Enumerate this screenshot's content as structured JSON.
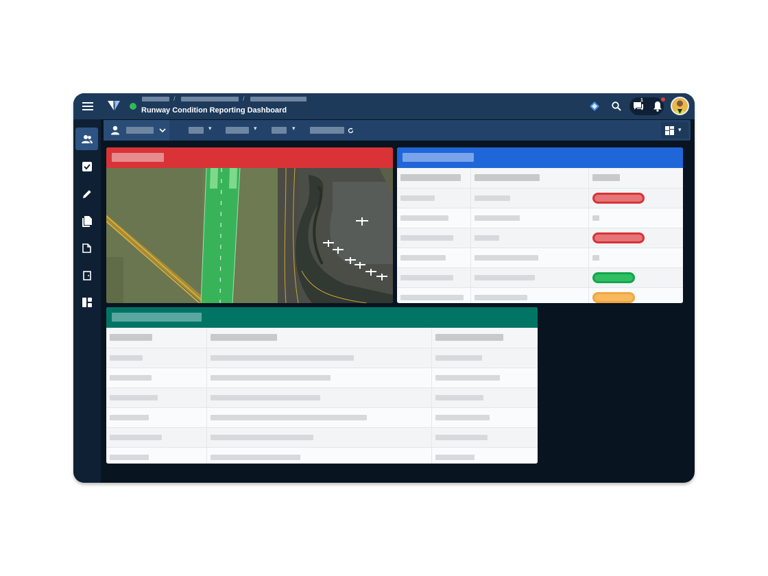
{
  "app": {
    "title": "Runway Condition Reporting Dashboard",
    "status": "online",
    "status_color": "#30b956",
    "breadcrumbs": [
      "",
      "",
      ""
    ],
    "messages_count": "1"
  },
  "icons": {
    "menu": "hamburger-icon",
    "logo": "shield-logo-icon",
    "ai": "diamond-icon",
    "search": "search-icon",
    "messages": "chat-icon",
    "notifications": "bell-icon",
    "user": "user-icon",
    "layout": "layout-grid-icon",
    "refresh": "refresh-icon"
  },
  "toolbar": {
    "user_label": "",
    "filters": [
      "",
      "",
      ""
    ],
    "refresh_label": ""
  },
  "sidebar": {
    "items": [
      {
        "icon": "users-icon",
        "active": true
      },
      {
        "icon": "checkbox-icon",
        "active": false
      },
      {
        "icon": "pencil-icon",
        "active": false
      },
      {
        "icon": "documents-icon",
        "active": false
      },
      {
        "icon": "note-icon",
        "active": false
      },
      {
        "icon": "door-icon",
        "active": false
      },
      {
        "icon": "dashboard-icon",
        "active": false
      }
    ]
  },
  "panels": {
    "map": {
      "title": "",
      "header_color": "#d93337"
    },
    "status_table": {
      "title": "",
      "header_color": "#1f66d9",
      "columns": [
        "",
        "",
        ""
      ],
      "rows": [
        {
          "status": "red"
        },
        {
          "status": "none"
        },
        {
          "status": "red"
        },
        {
          "status": "none"
        },
        {
          "status": "green"
        },
        {
          "status": "orange"
        }
      ]
    },
    "detail_table": {
      "title": "",
      "header_color": "#007565",
      "columns": [
        "",
        "",
        ""
      ],
      "row_count": 6
    }
  },
  "colors": {
    "red": "#d93337",
    "green": "#12a64b",
    "orange": "#f1a640",
    "nav": "#1d3a5b",
    "canvas": "#081420"
  }
}
